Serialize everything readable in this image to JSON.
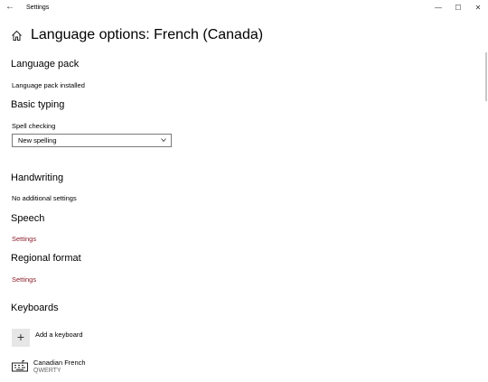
{
  "window": {
    "title": "Settings",
    "back_icon": "arrow-left-icon",
    "controls": {
      "minimize": "—",
      "maximize": "☐",
      "close": "✕"
    }
  },
  "header": {
    "title": "Language options: French (Canada)",
    "icon": "home-icon"
  },
  "language_pack": {
    "heading": "Language pack",
    "status": "Language pack installed"
  },
  "basic_typing": {
    "heading": "Basic typing",
    "spell_label": "Spell checking",
    "spell_selected": "New spelling"
  },
  "handwriting": {
    "heading": "Handwriting",
    "status": "No additional settings"
  },
  "speech": {
    "heading": "Speech",
    "link": "Settings"
  },
  "regional_format": {
    "heading": "Regional format",
    "link": "Settings"
  },
  "keyboards": {
    "heading": "Keyboards",
    "add_icon": "+",
    "add_label": "Add a keyboard",
    "items": [
      {
        "name": "Canadian French",
        "layout": "QWERTY",
        "icon": "keyboard-icon"
      }
    ]
  },
  "colors": {
    "link": "#8a1e2c",
    "tile": "#e6e6e6"
  }
}
